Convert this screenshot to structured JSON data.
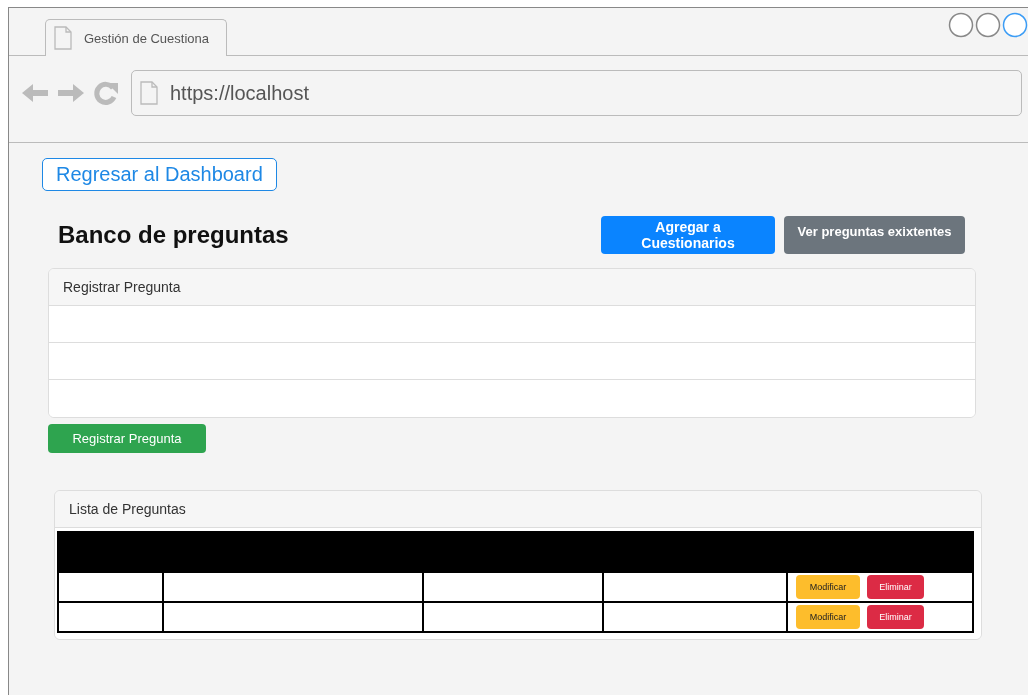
{
  "browser": {
    "tab_title": "Gestión de Cuestiona",
    "url": "https://localhost"
  },
  "back_link": "Regresar al Dashboard",
  "title": "Banco de preguntas",
  "header_buttons": [
    {
      "label": "Agregar a Cuestionarios",
      "kind": "primary"
    },
    {
      "label": "Ver preguntas exixtentes",
      "kind": "secondary"
    }
  ],
  "form_card": {
    "header": "Registrar Pregunta",
    "rows": [
      {
        "kind": "input"
      },
      {
        "kind": "input"
      },
      {
        "kind": "input"
      }
    ]
  },
  "submit_button": {
    "label": "Registrar Pregunta",
    "kind": "success"
  },
  "list_card": {
    "header": "Lista de Preguntas",
    "table": {
      "columns": [
        {
          "kind": "blank"
        },
        {
          "kind": "blank"
        },
        {
          "kind": "blank"
        },
        {
          "kind": "blank"
        },
        {
          "kind": "blank"
        }
      ],
      "rows": [
        {
          "cells": [
            {
              "kind": "blank"
            },
            {
              "kind": "blank"
            },
            {
              "kind": "blank"
            },
            {
              "kind": "blank"
            },
            {
              "kind": "actions",
              "buttons": [
                {
                  "label": "Modificar",
                  "kind": "warning"
                },
                {
                  "label": "Eliminar",
                  "kind": "danger"
                }
              ]
            }
          ]
        },
        {
          "cells": [
            {
              "kind": "blank"
            },
            {
              "kind": "blank"
            },
            {
              "kind": "blank"
            },
            {
              "kind": "blank"
            },
            {
              "kind": "actions",
              "buttons": [
                {
                  "label": "Modificar",
                  "kind": "warning"
                },
                {
                  "label": "Eliminar",
                  "kind": "danger"
                }
              ]
            }
          ]
        }
      ]
    }
  }
}
